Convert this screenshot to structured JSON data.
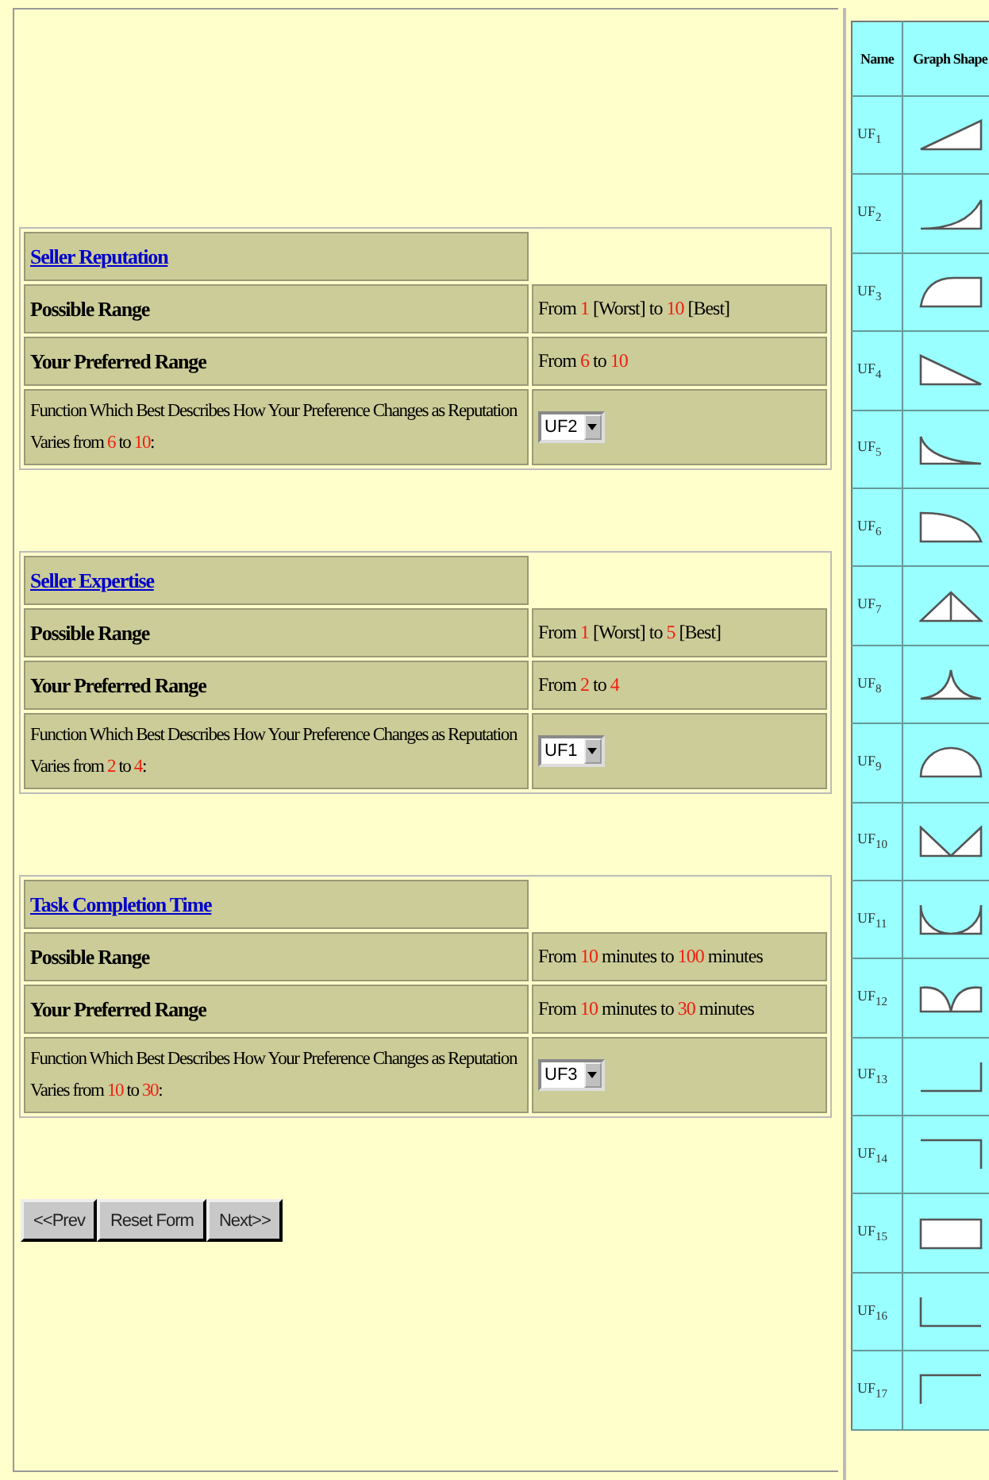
{
  "sections": [
    {
      "title": "Seller Reputation",
      "rows": [
        {
          "label": "Possible Range",
          "value": [
            {
              "text": "From ",
              "highlight": false
            },
            {
              "text": "1",
              "highlight": true
            },
            {
              "text": " [Worst] to ",
              "highlight": false
            },
            {
              "text": "10",
              "highlight": true
            },
            {
              "text": " [Best]",
              "highlight": false
            }
          ]
        },
        {
          "label": "Your Preferred Range",
          "value": [
            {
              "text": "From ",
              "highlight": false
            },
            {
              "text": "6",
              "highlight": true
            },
            {
              "text": " to ",
              "highlight": false
            },
            {
              "text": "10",
              "highlight": true
            }
          ]
        }
      ],
      "function_label": [
        {
          "text": "Function Which Best Describes How Your Preference Changes as Reputation Varies from ",
          "highlight": false
        },
        {
          "text": "6",
          "highlight": true
        },
        {
          "text": " to ",
          "highlight": false
        },
        {
          "text": "10",
          "highlight": true
        },
        {
          "text": ":",
          "highlight": false
        }
      ],
      "selected_function": "UF2"
    },
    {
      "title": "Seller Expertise",
      "rows": [
        {
          "label": "Possible Range",
          "value": [
            {
              "text": "From ",
              "highlight": false
            },
            {
              "text": "1",
              "highlight": true
            },
            {
              "text": " [Worst] to ",
              "highlight": false
            },
            {
              "text": "5",
              "highlight": true
            },
            {
              "text": " [Best]",
              "highlight": false
            }
          ]
        },
        {
          "label": "Your Preferred Range",
          "value": [
            {
              "text": "From ",
              "highlight": false
            },
            {
              "text": "2",
              "highlight": true
            },
            {
              "text": " to ",
              "highlight": false
            },
            {
              "text": "4",
              "highlight": true
            }
          ]
        }
      ],
      "function_label": [
        {
          "text": "Function Which Best Describes How Your Preference Changes as Reputation Varies from ",
          "highlight": false
        },
        {
          "text": "2",
          "highlight": true
        },
        {
          "text": " to ",
          "highlight": false
        },
        {
          "text": "4",
          "highlight": true
        },
        {
          "text": ":",
          "highlight": false
        }
      ],
      "selected_function": "UF1"
    },
    {
      "title": "Task Completion Time",
      "rows": [
        {
          "label": "Possible Range",
          "value": [
            {
              "text": "From ",
              "highlight": false
            },
            {
              "text": "10",
              "highlight": true
            },
            {
              "text": " minutes to ",
              "highlight": false
            },
            {
              "text": "100",
              "highlight": true
            },
            {
              "text": " minutes",
              "highlight": false
            }
          ]
        },
        {
          "label": "Your Preferred Range",
          "value": [
            {
              "text": "From ",
              "highlight": false
            },
            {
              "text": "10",
              "highlight": true
            },
            {
              "text": " minutes to ",
              "highlight": false
            },
            {
              "text": "30",
              "highlight": true
            },
            {
              "text": " minutes",
              "highlight": false
            }
          ]
        }
      ],
      "function_label": [
        {
          "text": "Function Which Best Describes How Your Preference Changes as Reputation Varies from ",
          "highlight": false
        },
        {
          "text": "10",
          "highlight": true
        },
        {
          "text": " to ",
          "highlight": false
        },
        {
          "text": "30",
          "highlight": true
        },
        {
          "text": ":",
          "highlight": false
        }
      ],
      "selected_function": "UF3"
    }
  ],
  "buttons": [
    "<<Prev",
    "Reset Form",
    "Next>>"
  ],
  "legend": {
    "columns": [
      "Name",
      "Graph Shape"
    ],
    "rows": [
      {
        "name": "UF$_{1}$",
        "kind": "ramp-up"
      },
      {
        "name": "UF$_{2}$",
        "kind": "convex-up"
      },
      {
        "name": "UF$_{3}$",
        "kind": "concave-up"
      },
      {
        "name": "UF$_{4}$",
        "kind": "ramp-down"
      },
      {
        "name": "UF$_{5}$",
        "kind": "decay"
      },
      {
        "name": "UF$_{6}$",
        "kind": "quarter-down"
      },
      {
        "name": "UF$_{7}$",
        "kind": "peak"
      },
      {
        "name": "UF$_{8}$",
        "kind": "cusp"
      },
      {
        "name": "UF$_{9}$",
        "kind": "semicircle"
      },
      {
        "name": "UF$_{10}$",
        "kind": "v-shape"
      },
      {
        "name": "UF$_{11}$",
        "kind": "bowl"
      },
      {
        "name": "UF$_{12}$",
        "kind": "double-arc"
      },
      {
        "name": "UF$_{13}$",
        "kind": "step-up"
      },
      {
        "name": "UF$_{14}$",
        "kind": "drop"
      },
      {
        "name": "UF$_{15}$",
        "kind": "box"
      },
      {
        "name": "UF$_{16}$",
        "kind": "low-step"
      },
      {
        "name": "UF$_{17}$",
        "kind": "high-step"
      }
    ]
  }
}
